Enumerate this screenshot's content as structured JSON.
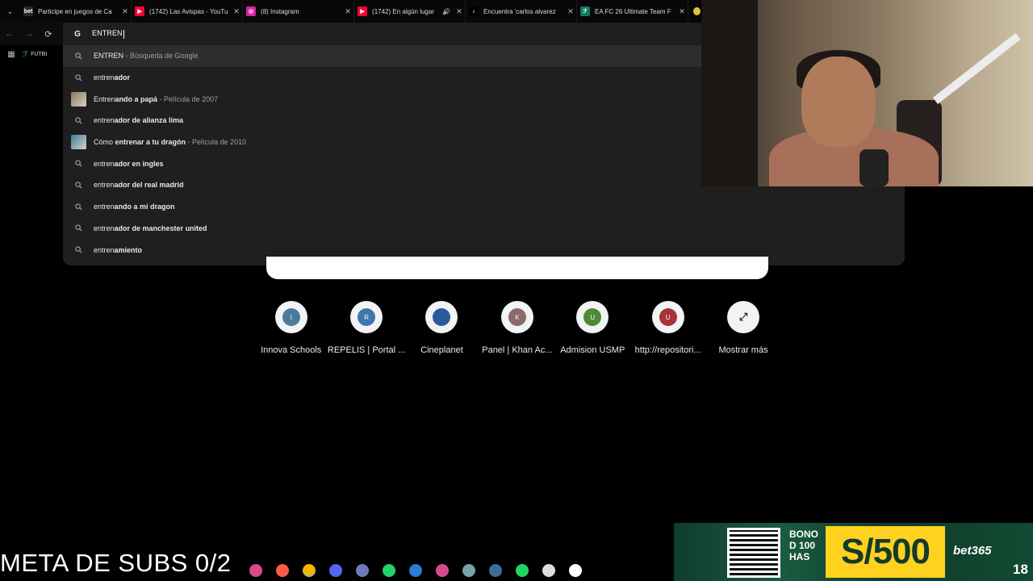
{
  "tabs": [
    {
      "title": "Participe en juegos de Ca",
      "favicon_color": "#2b2b2b",
      "favicon_glyph": "bet"
    },
    {
      "title": "(1742) Las Avispas - YouTu",
      "favicon_color": "#ff0033",
      "favicon_glyph": "▶"
    },
    {
      "title": "(8) Instagram",
      "favicon_color": "#d6249f",
      "favicon_glyph": "◎"
    },
    {
      "title": "(1742) En algún lugar",
      "favicon_color": "#ff0033",
      "favicon_glyph": "▶",
      "extra": "🔊"
    },
    {
      "title": "Encuentra 'carlos alvarez",
      "favicon_color": "#000000",
      "favicon_glyph": "♪"
    },
    {
      "title": "EA FC 26 Ultimate Team F",
      "favicon_color": "#0e7a5f",
      "favicon_glyph": "ℱ"
    }
  ],
  "bookmarks": {
    "item": "FUTBI"
  },
  "omnibox": {
    "text": "ENTREN",
    "suggestions": [
      {
        "typed": "ENTREN",
        "rest": "",
        "desc": " - Búsqueda de Google",
        "icon": "search-icon",
        "selected": true
      },
      {
        "typed": "entren",
        "rest": "ador",
        "desc": "",
        "icon": "search-icon"
      },
      {
        "typed": "Entren",
        "rest": "ando a papá",
        "desc": " - Película de 2007",
        "icon": "thumbnail",
        "thumb_color": "#8a7560"
      },
      {
        "typed": "entren",
        "rest": "ador de alianza lima",
        "desc": "",
        "icon": "search-icon"
      },
      {
        "typed": "Cómo ",
        "rest": "entrenar a tu dragón",
        "desc": " - Película de 2010",
        "icon": "thumbnail",
        "thumb_color": "#3c7fa0"
      },
      {
        "typed": "entren",
        "rest": "ador en ingles",
        "desc": "",
        "icon": "search-icon"
      },
      {
        "typed": "entren",
        "rest": "ador del real madrid",
        "desc": "",
        "icon": "search-icon"
      },
      {
        "typed": "entren",
        "rest": "ando a mi dragon",
        "desc": "",
        "icon": "search-icon"
      },
      {
        "typed": "entren",
        "rest": "ador de manchester united",
        "desc": "",
        "icon": "search-icon"
      },
      {
        "typed": "entren",
        "rest": "amiento",
        "desc": "",
        "icon": "search-icon"
      }
    ]
  },
  "shortcuts": [
    {
      "letter": "I",
      "label": "Innova Schools",
      "color": "#4a7b9a"
    },
    {
      "letter": "R",
      "label": "REPELIS | Portal ...",
      "color": "#3f78a8"
    },
    {
      "letter": "",
      "label": "Cineplanet",
      "color": "#2a5a9a"
    },
    {
      "letter": "K",
      "label": "Panel | Khan Ac...",
      "color": "#8a6a6a"
    },
    {
      "letter": "U",
      "label": "Admision USMP",
      "color": "#4e8a36"
    },
    {
      "letter": "U",
      "label": "http://repositori...",
      "color": "#a8323a"
    },
    {
      "letter": "",
      "label": "Mostrar más",
      "color": "#f1f3f4"
    }
  ],
  "overlay": {
    "meta_subs": "META DE SUBS 0/2"
  },
  "taskbar": [
    {
      "name": "app-icon",
      "color": "#d94a8c"
    },
    {
      "name": "app-icon",
      "color": "#ff5a4a"
    },
    {
      "name": "chrome-icon",
      "color": "#f4b400",
      "active": true
    },
    {
      "name": "app-icon",
      "color": "#5865f2"
    },
    {
      "name": "calculator-icon",
      "color": "#6e7bb8"
    },
    {
      "name": "whatsapp-icon",
      "color": "#25d366"
    },
    {
      "name": "word-icon",
      "color": "#2b7cd3"
    },
    {
      "name": "app-icon",
      "color": "#d94a8c"
    },
    {
      "name": "app-icon",
      "color": "#7aa3a8"
    },
    {
      "name": "steam-icon",
      "color": "#3d6c99"
    },
    {
      "name": "spotify-icon",
      "color": "#1ed760"
    },
    {
      "name": "app-icon",
      "color": "#dddddd"
    },
    {
      "name": "tiktok-icon",
      "color": "#ffffff"
    }
  ],
  "ad": {
    "bono": "BONO D 100 HAS",
    "amount": "S/500",
    "brand": "bet365",
    "age": "18"
  }
}
